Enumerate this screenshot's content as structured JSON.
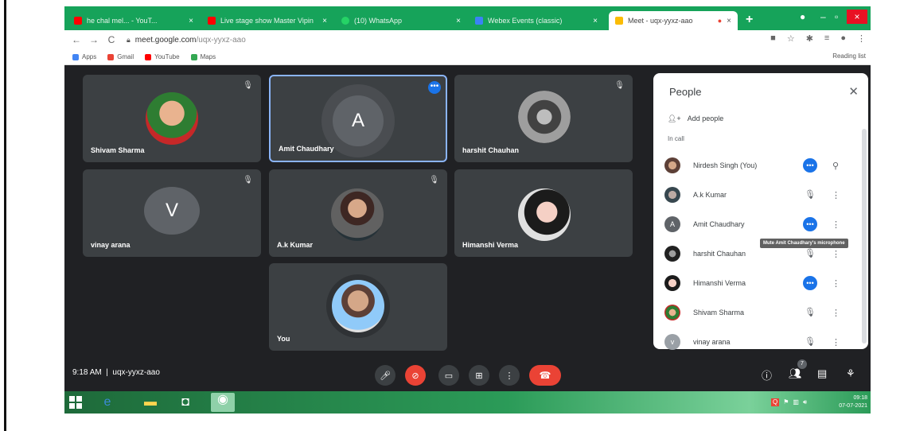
{
  "browser": {
    "tabs": [
      {
        "title": "he chal mel... - YouT...",
        "favicon_color": "#ff0000"
      },
      {
        "title": "Live stage show Master Vipin",
        "favicon_color": "#ff0000"
      },
      {
        "title": "(10) WhatsApp",
        "favicon_color": "#25d366"
      },
      {
        "title": "Webex Events (classic)",
        "favicon_color": "#3b82f6"
      },
      {
        "title": "Meet - uqx-yyxz-aao",
        "favicon_color": "#fbbc04"
      }
    ],
    "url_host": "meet.google.com",
    "url_path": "/uqx-yyxz-aao",
    "bookmarks": [
      {
        "label": "Apps",
        "color": "#4285f4"
      },
      {
        "label": "Gmail",
        "color": "#ea4335"
      },
      {
        "label": "YouTube",
        "color": "#ff0000"
      },
      {
        "label": "Maps",
        "color": "#34a853"
      }
    ],
    "reading_list": "Reading list"
  },
  "tiles": [
    {
      "name": "Shivam Sharma"
    },
    {
      "name": "Amit Chaudhary",
      "initial": "A",
      "color": "#5f6368"
    },
    {
      "name": "harshit Chauhan"
    },
    {
      "name": "vinay arana",
      "initial": "V",
      "color": "#5f6368"
    },
    {
      "name": "A.k Kumar"
    },
    {
      "name": "Himanshi Verma"
    },
    {
      "name": "You"
    }
  ],
  "meeting": {
    "time": "9:18 AM",
    "code": "uqx-yyxz-aao",
    "people_count": "7"
  },
  "people_panel": {
    "title": "People",
    "add_people": "Add people",
    "in_call": "In call",
    "tooltip": "Mute Amit Chaudhary's microphone",
    "participants": [
      {
        "name": "Nirdesh Singh (You)"
      },
      {
        "name": "A.k Kumar"
      },
      {
        "name": "Amit Chaudhary",
        "initial": "A"
      },
      {
        "name": "harshit Chauhan"
      },
      {
        "name": "Himanshi Verma"
      },
      {
        "name": "Shivam Sharma"
      },
      {
        "name": "vinay arana",
        "initial": "v"
      }
    ]
  },
  "taskbar": {
    "time": "09:18",
    "date": "07-07-2021"
  }
}
